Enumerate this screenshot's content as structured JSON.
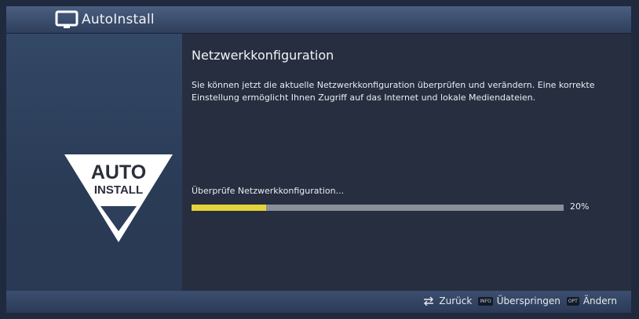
{
  "window": {
    "title": "AutoInstall"
  },
  "logo": {
    "line1": "AUTO",
    "line2": "INSTALL"
  },
  "content": {
    "heading": "Netzwerkkonfiguration",
    "description": "Sie können jetzt die aktuelle Netzwerkkonfiguration überprüfen und verändern. Eine korrekte Einstellung ermöglicht Ihnen Zugriff auf das Internet und lokale Mediendateien.",
    "status_text": "Überprüfe Netzwerkkonfiguration...",
    "progress_value": 0.2,
    "progress_label": "20%"
  },
  "footer": {
    "back_label": "Zurück",
    "skip_key": "INFO",
    "skip_label": "Überspringen",
    "change_key": "OPT",
    "change_label": "Ändern"
  },
  "colors": {
    "progress_fill": "#e3d43a",
    "progress_track": "#8a8f99",
    "titlebar": "#3d5173",
    "content_bg": "#272e40"
  },
  "icons": {
    "title_icon": "tv-icon",
    "back_icon": "swap-arrows-icon"
  }
}
